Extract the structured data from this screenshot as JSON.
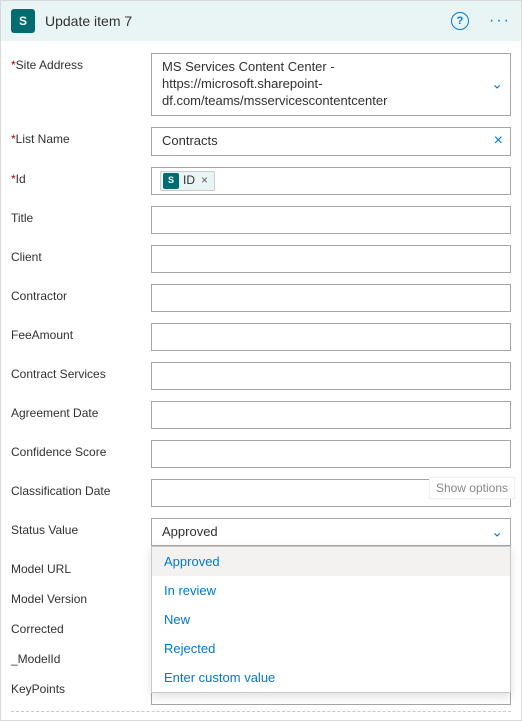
{
  "header": {
    "app_letter": "S",
    "title": "Update item 7",
    "help": "?",
    "more": "···"
  },
  "fields": {
    "site_address": {
      "label": "Site Address",
      "value": "MS Services Content Center - https://microsoft.sharepoint-df.com/teams/msservicescontentcenter"
    },
    "list_name": {
      "label": "List Name",
      "value": "Contracts"
    },
    "id_field": {
      "label": "Id",
      "token_label": "ID"
    },
    "title": {
      "label": "Title"
    },
    "client": {
      "label": "Client"
    },
    "contractor": {
      "label": "Contractor"
    },
    "fee_amount": {
      "label": "FeeAmount"
    },
    "contract_services": {
      "label": "Contract Services"
    },
    "agreement_date": {
      "label": "Agreement Date"
    },
    "confidence_score": {
      "label": "Confidence Score"
    },
    "classification_date": {
      "label": "Classification Date"
    },
    "status_value": {
      "label": "Status Value",
      "value": "Approved"
    },
    "model_url": {
      "label": "Model URL"
    },
    "model_version": {
      "label": "Model Version"
    },
    "corrected": {
      "label": "Corrected"
    },
    "model_id": {
      "label": "_ModelId"
    },
    "key_points": {
      "label": "KeyPoints"
    }
  },
  "show_options": "Show options",
  "dropdown": {
    "items": [
      "Approved",
      "In review",
      "New",
      "Rejected",
      "Enter custom value"
    ]
  },
  "required_mark": "*"
}
